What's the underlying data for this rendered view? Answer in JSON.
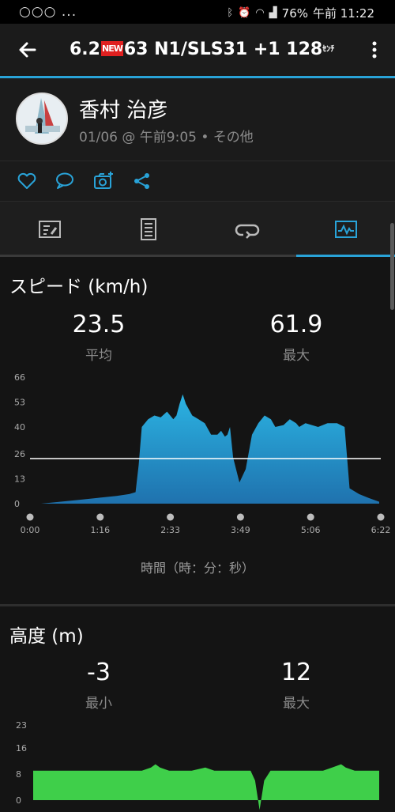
{
  "status_bar": {
    "left_icons": "○○○ ...",
    "battery": "76%",
    "time": "午前 11:22"
  },
  "app_bar": {
    "title_prefix": "6.2",
    "new_badge": "NEW",
    "title_rest": "63 N1/SLS31 +1 128",
    "title_suffix": "ｾﾝﾁ"
  },
  "profile": {
    "name": "香村 治彦",
    "meta": "01/06 @ 午前9:05 • その他"
  },
  "colors": {
    "accent": "#29a3d8",
    "speed_fill_top": "#2bb3e2",
    "speed_fill_bottom": "#1f72ae",
    "altitude_fill": "#3fcf4a",
    "background": "#141414"
  },
  "icons": [
    "heart-icon",
    "comment-icon",
    "camera-add-icon",
    "share-icon",
    "summary-tab-icon",
    "details-tab-icon",
    "laps-tab-icon",
    "charts-tab-icon"
  ],
  "speed": {
    "title": "スピード (km/h)",
    "avg_value": "23.5",
    "avg_label": "平均",
    "max_value": "61.9",
    "max_label": "最大",
    "x_axis_label": "時間（時：分：秒）"
  },
  "altitude": {
    "title": "高度 (m)",
    "min_value": "-3",
    "min_label": "最小",
    "max_value": "12",
    "max_label": "最大"
  },
  "chart_data": [
    {
      "type": "area",
      "ylim": [
        0,
        66
      ],
      "y_ticks": [
        "0",
        "13",
        "26",
        "40",
        "53",
        "66"
      ],
      "x_ticks": [
        "0:00",
        "1:16",
        "2:33",
        "3:49",
        "5:06",
        "6:22"
      ],
      "xlim_seconds": [
        0,
        382
      ],
      "average_line": 23.5,
      "x_seconds": [
        0,
        30,
        60,
        90,
        120,
        140,
        150,
        155,
        160,
        170,
        180,
        190,
        200,
        210,
        215,
        220,
        225,
        230,
        240,
        250,
        260,
        270,
        280,
        286,
        292,
        296,
        300,
        305,
        315,
        325,
        335,
        345,
        355,
        365,
        372,
        385,
        395,
        405,
        410,
        420,
        440,
        455,
        470,
        482,
        490,
        505,
        520,
        537
      ],
      "values": [
        0,
        1,
        2,
        3,
        4,
        5,
        6,
        20,
        40,
        44,
        46,
        45,
        48,
        44,
        46,
        52,
        57,
        52,
        46,
        44,
        42,
        36,
        36,
        38,
        35,
        36,
        40,
        24,
        11,
        18,
        36,
        42,
        46,
        44,
        40,
        41,
        44,
        42,
        40,
        42,
        40,
        42,
        42,
        40,
        8,
        5,
        3,
        1
      ]
    },
    {
      "type": "area",
      "ylim": [
        0,
        23
      ],
      "y_ticks": [
        "0",
        "8",
        "16",
        "23"
      ],
      "values_note_hidden": "",
      "x_seconds": [
        0,
        40,
        80,
        120,
        130,
        135,
        140,
        150,
        175,
        190,
        200,
        230,
        240,
        245,
        250,
        255,
        262,
        280,
        300,
        320,
        330,
        340,
        345,
        355,
        382
      ],
      "values": [
        9,
        9,
        9,
        9,
        10,
        11,
        10,
        9,
        9,
        10,
        9,
        9,
        9,
        6,
        -3,
        6,
        9,
        9,
        9,
        9,
        10,
        11,
        10,
        9,
        9
      ]
    }
  ]
}
